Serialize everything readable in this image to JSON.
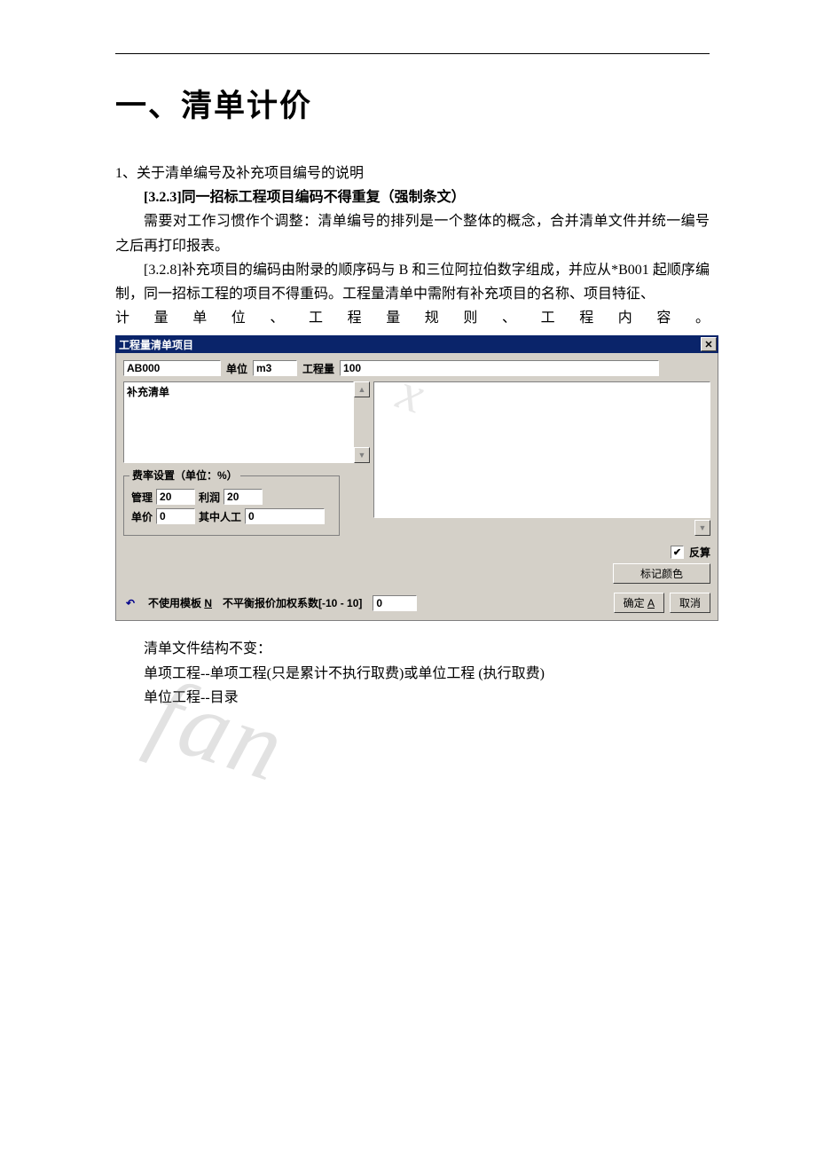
{
  "document": {
    "title": "一、清单计价",
    "section1_num": "1、",
    "section1_text": "关于清单编号及补充项目编号的说明",
    "rule_323": "[3.2.3]同一招标工程项目编码不得重复（强制条文）",
    "para1": "需要对工作习惯作个调整：清单编号的排列是一个整体的概念，合并清单文件并统一编号之后再打印报表。",
    "para2": "[3.2.8]补充项目的编码由附录的顺序码与 B 和三位阿拉伯数字组成，并应从*B001 起顺序编制，同一招标工程的项目不得重码。工程量清单中需附有补充项目的名称、项目特征、",
    "para2_last": "计量单位、工程量规则、工程内容。",
    "after1": "清单文件结构不变：",
    "after2": "单项工程--单项工程(只是累计不执行取费)或单位工程 (执行取费)",
    "after3": "单位工程--目录"
  },
  "dialog": {
    "title": "工程量清单项目",
    "code_value": "AB000",
    "unit_label": "单位",
    "unit_value": "m3",
    "qty_label": "工程量",
    "qty_value": "100",
    "textarea_left": "补充清单",
    "group_title": "费率设置（单位：%）",
    "mgmt_label": "管理",
    "mgmt_value": "20",
    "profit_label": "利润",
    "profit_value": "20",
    "price_label": "单价",
    "price_value": "0",
    "labor_label": "其中人工",
    "labor_value": "0",
    "reverse_label": "反算",
    "marker_label": "标记颜色",
    "no_template_label_pre": "不使用模板 ",
    "no_template_key": "N",
    "coef_label": "不平衡报价加权系数[-10 - 10]",
    "coef_value": "0",
    "ok_label_pre": "确定 ",
    "ok_key": "A",
    "cancel_label": "取消",
    "close_glyph": "✕",
    "up_glyph": "▲",
    "down_glyph": "▼",
    "check_glyph": "✔",
    "undo_glyph": "↶"
  },
  "watermark": {
    "big": "fan",
    "small": "x"
  }
}
